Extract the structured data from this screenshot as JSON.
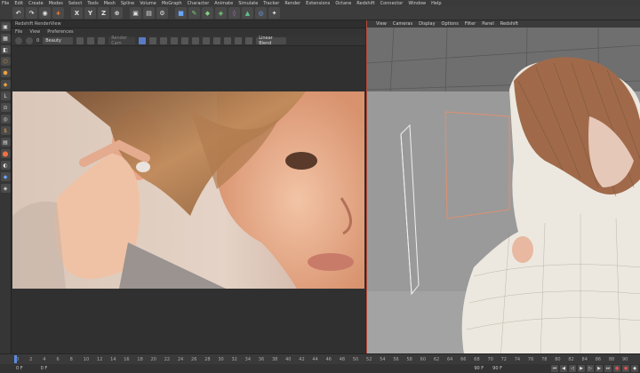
{
  "menubar": [
    "File",
    "Edit",
    "Create",
    "Modes",
    "Select",
    "Tools",
    "Mesh",
    "Spline",
    "Volume",
    "MoGraph",
    "Character",
    "Animate",
    "Simulate",
    "Tracker",
    "Render",
    "Extensions",
    "Octane",
    "Redshift",
    "Connector",
    "Window",
    "Help"
  ],
  "toolbar": {
    "icons": [
      "move-icon",
      "scale-icon",
      "rotate-icon",
      "x-axis-icon",
      "y-axis-icon",
      "z-axis-icon",
      "coord-icon",
      "render-region-icon",
      "render-view-icon",
      "render-settings-icon",
      "cube-icon",
      "pen-icon",
      "subdivide-icon",
      "array-icon",
      "deformer-icon",
      "scene-icon",
      "camera-icon",
      "light-icon"
    ],
    "labels": [
      "+",
      "X",
      "Y",
      "Z"
    ]
  },
  "render_view": {
    "title": "Redshift RenderView",
    "menu": [
      "File",
      "View",
      "Preferences"
    ],
    "frame": "0",
    "aov": "Beauty",
    "camera": "Render Cam",
    "snapshot": "Linear Blend"
  },
  "viewport": {
    "menu": [
      "View",
      "Cameras",
      "Display",
      "Options",
      "Filter",
      "Panel",
      "Redshift"
    ]
  },
  "timeline": {
    "ticks": [
      "0",
      "2",
      "4",
      "6",
      "8",
      "10",
      "12",
      "14",
      "16",
      "18",
      "20",
      "22",
      "24",
      "26",
      "28",
      "30",
      "32",
      "34",
      "36",
      "38",
      "40",
      "42",
      "44",
      "46",
      "48",
      "50",
      "52",
      "54",
      "56",
      "58",
      "60",
      "62",
      "64",
      "66",
      "68",
      "70",
      "72",
      "74",
      "76",
      "78",
      "80",
      "82",
      "84",
      "86",
      "88",
      "90"
    ],
    "start": "0 F",
    "current": "0 F",
    "end": "90 F",
    "end2": "90 F"
  }
}
